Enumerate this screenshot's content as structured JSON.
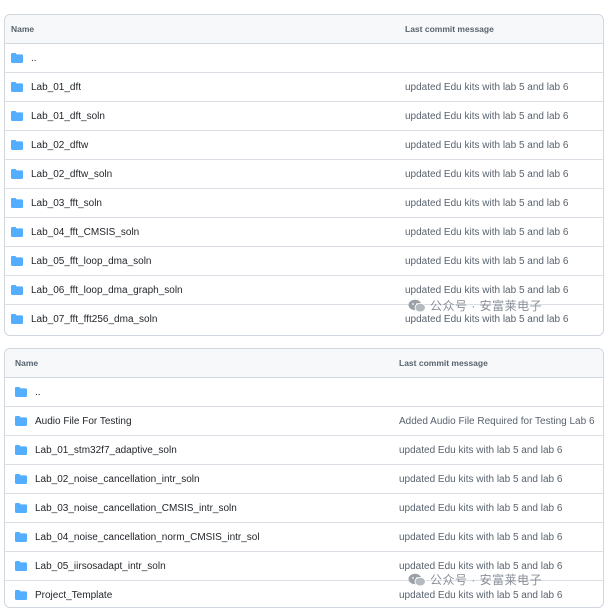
{
  "colors": {
    "folder": "#54aeff",
    "border": "#d0d7de",
    "header_bg": "#f6f8fa",
    "muted_text": "#59636e"
  },
  "table1": {
    "header": {
      "name": "Name",
      "message": "Last commit message"
    },
    "rows": [
      {
        "name": "..",
        "message": ""
      },
      {
        "name": "Lab_01_dft",
        "message": "updated Edu kits with lab 5 and lab 6"
      },
      {
        "name": "Lab_01_dft_soln",
        "message": "updated Edu kits with lab 5 and lab 6"
      },
      {
        "name": "Lab_02_dftw",
        "message": "updated Edu kits with lab 5 and lab 6"
      },
      {
        "name": "Lab_02_dftw_soln",
        "message": "updated Edu kits with lab 5 and lab 6"
      },
      {
        "name": "Lab_03_fft_soln",
        "message": "updated Edu kits with lab 5 and lab 6"
      },
      {
        "name": "Lab_04_fft_CMSIS_soln",
        "message": "updated Edu kits with lab 5 and lab 6"
      },
      {
        "name": "Lab_05_fft_loop_dma_soln",
        "message": "updated Edu kits with lab 5 and lab 6"
      },
      {
        "name": "Lab_06_fft_loop_dma_graph_soln",
        "message": "updated Edu kits with lab 5 and lab 6"
      },
      {
        "name": "Lab_07_fft_fft256_dma_soln",
        "message": "updated Edu kits with lab 5 and lab 6"
      }
    ]
  },
  "table2": {
    "header": {
      "name": "Name",
      "message": "Last commit message"
    },
    "rows": [
      {
        "name": "..",
        "message": ""
      },
      {
        "name": "Audio File For Testing",
        "message": "Added Audio File Required for Testing Lab 6"
      },
      {
        "name": "Lab_01_stm32f7_adaptive_soln",
        "message": "updated Edu kits with lab 5 and lab 6"
      },
      {
        "name": "Lab_02_noise_cancellation_intr_soln",
        "message": "updated Edu kits with lab 5 and lab 6"
      },
      {
        "name": "Lab_03_noise_cancellation_CMSIS_intr_soln",
        "message": "updated Edu kits with lab 5 and lab 6"
      },
      {
        "name": "Lab_04_noise_cancellation_norm_CMSIS_intr_sol",
        "message": "updated Edu kits with lab 5 and lab 6"
      },
      {
        "name": "Lab_05_iirsosadapt_intr_soln",
        "message": "updated Edu kits with lab 5 and lab 6"
      },
      {
        "name": "Project_Template",
        "message": "updated Edu kits with lab 5 and lab 6"
      }
    ]
  },
  "watermark": {
    "text": "公众号 · 安富莱电子",
    "icon": "wechat-icon"
  }
}
